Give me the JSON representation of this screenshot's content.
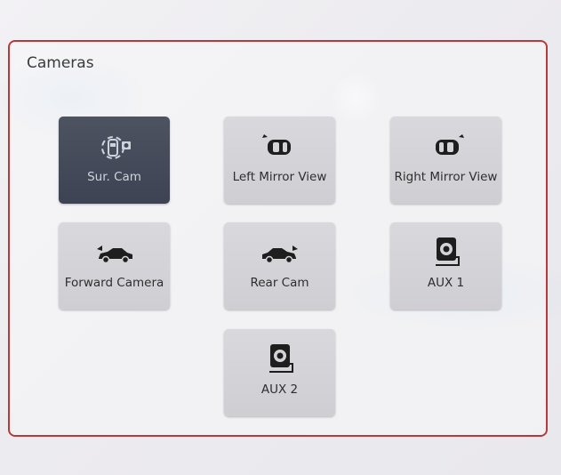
{
  "panel": {
    "title": "Cameras"
  },
  "tiles": [
    {
      "label": "Sur. Cam",
      "icon": "surround-camera-icon",
      "selected": true
    },
    {
      "label": "Left Mirror View",
      "icon": "left-mirror-car-icon",
      "selected": false
    },
    {
      "label": "Right Mirror View",
      "icon": "right-mirror-car-icon",
      "selected": false
    },
    {
      "label": "Forward Camera",
      "icon": "car-side-icon",
      "selected": false
    },
    {
      "label": "Rear Cam",
      "icon": "car-side-icon",
      "selected": false
    },
    {
      "label": "AUX 1",
      "icon": "aux-camera-icon",
      "selected": false
    },
    {
      "label": "AUX 2",
      "icon": "aux-camera-icon",
      "selected": false
    }
  ],
  "colors": {
    "frame_border": "#b73a3a",
    "tile_selected": "#434958",
    "tile_default": "#d4d3d8"
  }
}
